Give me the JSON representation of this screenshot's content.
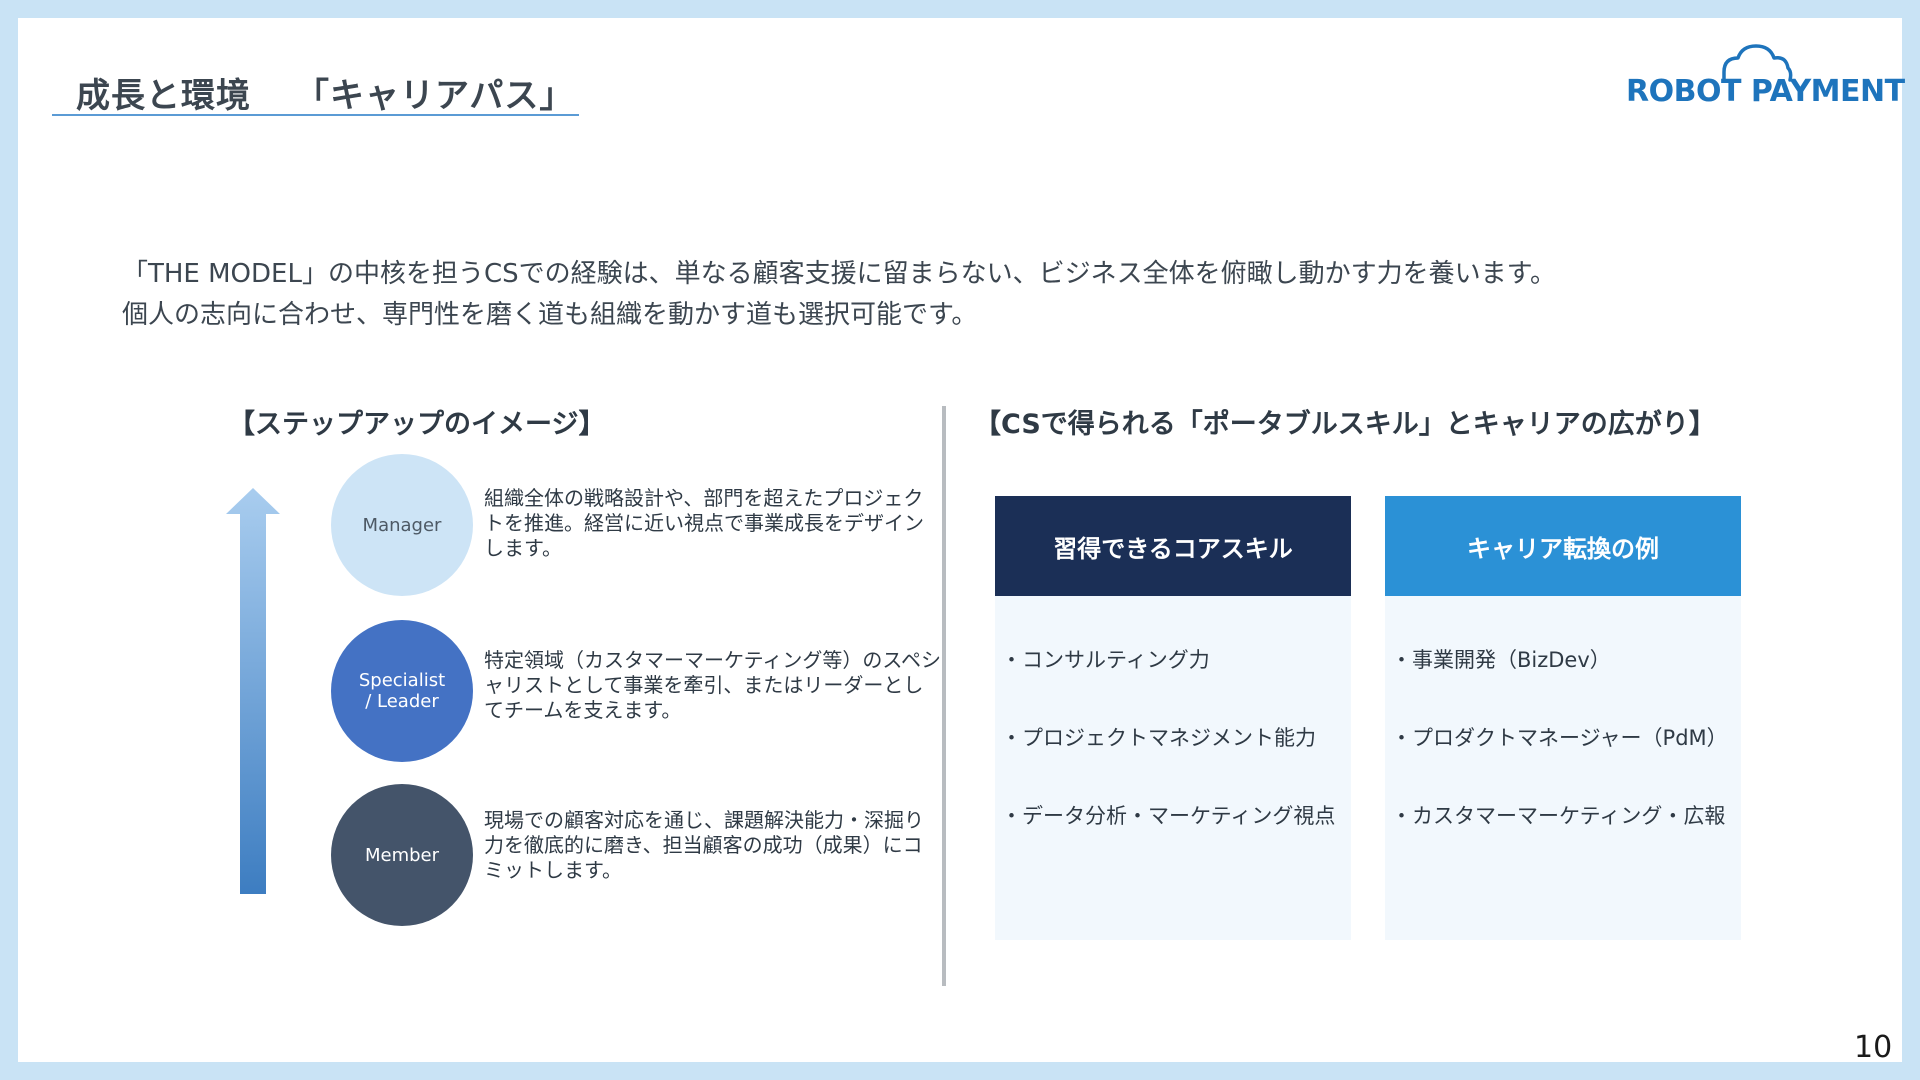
{
  "header": {
    "title_main": "成長と環境",
    "title_sub": "「キャリアパス」",
    "logo_text": "ROBOT PAYMENT",
    "logo_icon": "cloud-icon"
  },
  "intro": {
    "line1": "「THE MODEL」の中核を担うCSでの経験は、単なる顧客支援に留まらない、ビジネス全体を俯瞰し動かす力を養います。",
    "line2": "個人の志向に合わせ、専門性を磨く道も組織を動かす道も選択可能です。"
  },
  "left_section": {
    "title": "【ステップアップのイメージ】",
    "levels": [
      {
        "name": "Manager",
        "description": "組織全体の戦略設計や、部門を超えたプロジェクトを推進。経営に近い視点で事業成長をデザインします。"
      },
      {
        "name_line1": "Specialist",
        "name_line2": "/ Leader",
        "description": "特定領域（カスタマーマーケティング等）のスペシャリストとして事業を牽引、またはリーダーとしてチームを支えます。"
      },
      {
        "name": "Member",
        "description": "現場での顧客対応を通じ、課題解決能力・深掘り力を徹底的に磨き、担当顧客の成功（成果）にコミットします。"
      }
    ]
  },
  "right_section": {
    "title": "【CSで得られる「ポータブルスキル」とキャリアの広がり】",
    "panels": [
      {
        "header": "習得できるコアスキル",
        "items": [
          "・コンサルティング力",
          "・プロジェクトマネジメント能力",
          "・データ分析・マーケティング視点"
        ]
      },
      {
        "header": "キャリア転換の例",
        "items": [
          "・事業開発（BizDev）",
          "・プロダクトマネージャー（PdM）",
          "・カスタマーマーケティング・広報"
        ]
      }
    ]
  },
  "colors": {
    "accent_blue": "#2b91d6",
    "navy": "#1b2f56",
    "manager_circle": "#cde4f6",
    "specialist_circle": "#4472c4",
    "member_circle": "#44546a"
  },
  "page_number": "10"
}
